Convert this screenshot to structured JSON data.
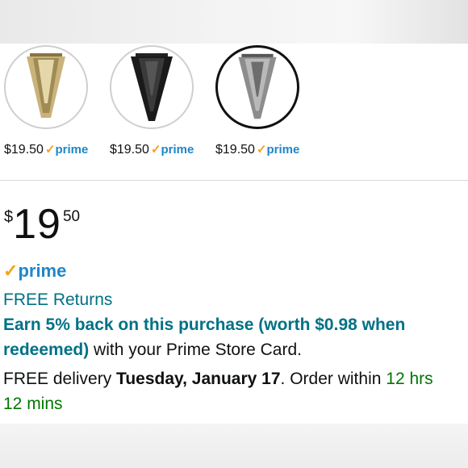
{
  "colors": {
    "link_teal": "#007185",
    "prime_blue": "#1f86c8",
    "prime_check": "#f5a21b",
    "countdown_green": "#007600"
  },
  "swatches": [
    {
      "price": "$19.50",
      "prime": "prime",
      "icon": "gold-crystal-chandelier-icon",
      "selected": false
    },
    {
      "price": "$19.50",
      "prime": "prime",
      "icon": "black-crystal-chandelier-icon",
      "selected": false
    },
    {
      "price": "$19.50",
      "prime": "prime",
      "icon": "silver-crystal-chandelier-icon",
      "selected": true
    }
  ],
  "price": {
    "symbol": "$",
    "whole": "19",
    "fraction": "50"
  },
  "prime_badge": {
    "check": "✓",
    "label": "prime"
  },
  "returns": "FREE Returns",
  "earn": {
    "line1": "Earn 5% back on this purchase (worth $0.98 when",
    "line2_bold": "redeemed)",
    "line2_rest": " with your Prime Store Card."
  },
  "delivery": {
    "prefix": "FREE delivery ",
    "date": "Tuesday, January 17",
    "middle": ". Order within ",
    "countdown_1": "12 hrs",
    "countdown_2": "12 mins"
  }
}
